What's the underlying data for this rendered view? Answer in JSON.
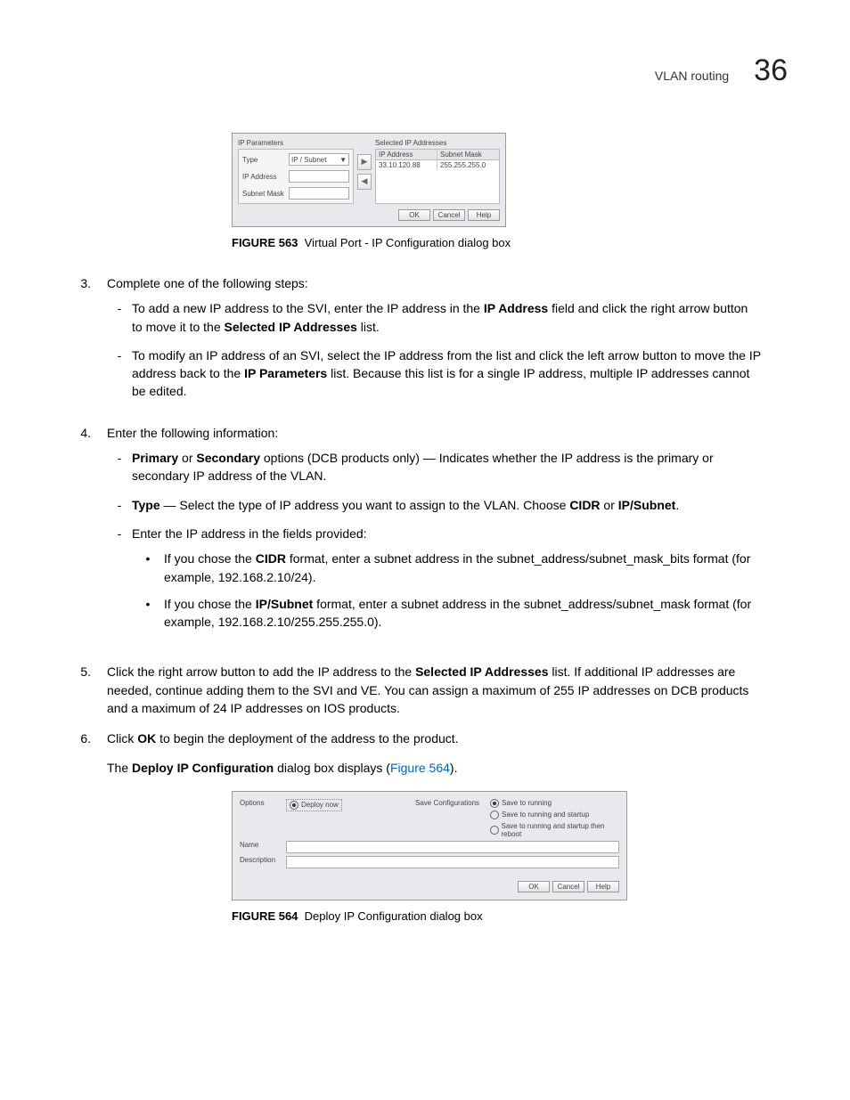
{
  "header": {
    "title": "VLAN routing",
    "chapter_num": "36"
  },
  "dialog1": {
    "left_title": "IP Parameters",
    "fields": {
      "type_label": "Type",
      "type_value": "IP / Subnet",
      "ip_label": "IP Address",
      "mask_label": "Subnet Mask"
    },
    "right_title": "Selected IP Addresses",
    "table": {
      "h1": "IP Address",
      "h2": "Subnet Mask",
      "r1c1": "33.10.120.88",
      "r1c2": "255.255.255.0"
    },
    "buttons": {
      "ok": "OK",
      "cancel": "Cancel",
      "help": "Help"
    }
  },
  "fig1": {
    "num": "FIGURE 563",
    "title": "Virtual Port - IP Configuration dialog box"
  },
  "step3": {
    "num": "3.",
    "lead": "Complete one of the following steps:",
    "a_pre": "To add a new IP address to the SVI, enter the IP address in the ",
    "a_b1": "IP Address",
    "a_mid": " field and click the right arrow button to move it to the ",
    "a_b2": "Selected IP Addresses",
    "a_end": " list.",
    "b_pre": "To modify an IP address of an SVI, select the IP address from the list and click the left arrow button to move the IP address back to the ",
    "b_b1": "IP Parameters",
    "b_end": " list. Because this list is for a single IP address, multiple IP addresses cannot be edited."
  },
  "step4": {
    "num": "4.",
    "lead": "Enter the following information:",
    "a_b1": "Primary",
    "a_mid1": " or ",
    "a_b2": "Secondary",
    "a_rest": " options (DCB products only) — Indicates whether the IP address is the primary or secondary IP address of the VLAN.",
    "b_b1": "Type",
    "b_mid": " — Select the type of IP address you want to assign to the VLAN. Choose ",
    "b_b2": "CIDR",
    "b_or": " or ",
    "b_b3": "IP/Subnet",
    "b_end": ".",
    "c_lead": "Enter the IP address in the fields provided:",
    "c1_pre": "If you chose the ",
    "c1_b": "CIDR",
    "c1_rest": " format, enter a subnet address in the subnet_address/subnet_mask_bits format (for example, 192.168.2.10/24).",
    "c2_pre": "If you chose the ",
    "c2_b": "IP/Subnet",
    "c2_rest": " format, enter a subnet address in the subnet_address/subnet_mask format (for example, 192.168.2.10/255.255.255.0)."
  },
  "step5": {
    "num": "5.",
    "pre": "Click the right arrow button to add the IP address to the ",
    "b1": "Selected IP Addresses",
    "rest": " list. If additional IP addresses are needed, continue adding them to the SVI and VE. You can assign a maximum of 255 IP addresses on DCB products and a maximum of 24 IP addresses on IOS products."
  },
  "step6": {
    "num": "6.",
    "pre": "Click ",
    "b1": "OK",
    "rest": " to begin the deployment of the address to the product."
  },
  "follow": {
    "pre": "The ",
    "b1": "Deploy IP Configuration",
    "mid": " dialog box displays (",
    "link": "Figure 564",
    "end": ")."
  },
  "dialog2": {
    "options_label": "Options",
    "deploy_now": "Deploy now",
    "saveconf_label": "Save Configurations",
    "r1": "Save to running",
    "r2": "Save to running and startup",
    "r3": "Save to running and startup then reboot",
    "name_label": "Name",
    "desc_label": "Description",
    "buttons": {
      "ok": "OK",
      "cancel": "Cancel",
      "help": "Help"
    }
  },
  "fig2": {
    "num": "FIGURE 564",
    "title": "Deploy IP Configuration dialog box"
  }
}
